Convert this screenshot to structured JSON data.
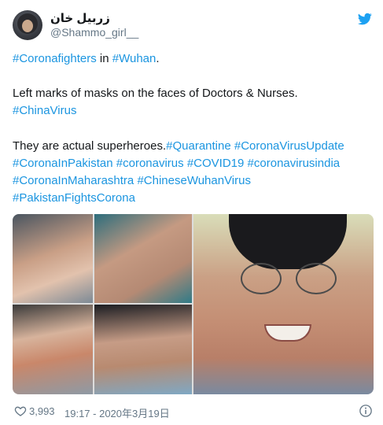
{
  "user": {
    "display_name": "زربیل خان",
    "handle": "@Shammo_girl__"
  },
  "tweet": {
    "line1": {
      "tag1": "#Coronafighters",
      "mid": " in ",
      "tag2": "#Wuhan",
      "end": "."
    },
    "line2": "Left marks of masks on the faces of Doctors & Nurses.",
    "line3": "#ChinaVirus",
    "line4": {
      "text": "They are actual superheroes.",
      "tag1": "#Quarantine",
      "tag2": "#CoronaVirusUpdate"
    },
    "line5": [
      "#CoronaInPakistan",
      "#coronavirus",
      "#COVID19",
      "#coronavirusindia"
    ],
    "line6": [
      "#CoronaInMaharashtra",
      "#ChineseWuhanVirus"
    ],
    "line7": "#PakistanFightsCorona"
  },
  "footer": {
    "likes": "3,993",
    "timestamp": "19:17 - 2020年3月19日"
  },
  "icons": [
    "twitter-bird-icon",
    "heart-icon",
    "info-icon"
  ],
  "colors": {
    "link": "#1b95e0",
    "text": "#14171a",
    "muted": "#657786",
    "bird": "#1da1f2"
  }
}
